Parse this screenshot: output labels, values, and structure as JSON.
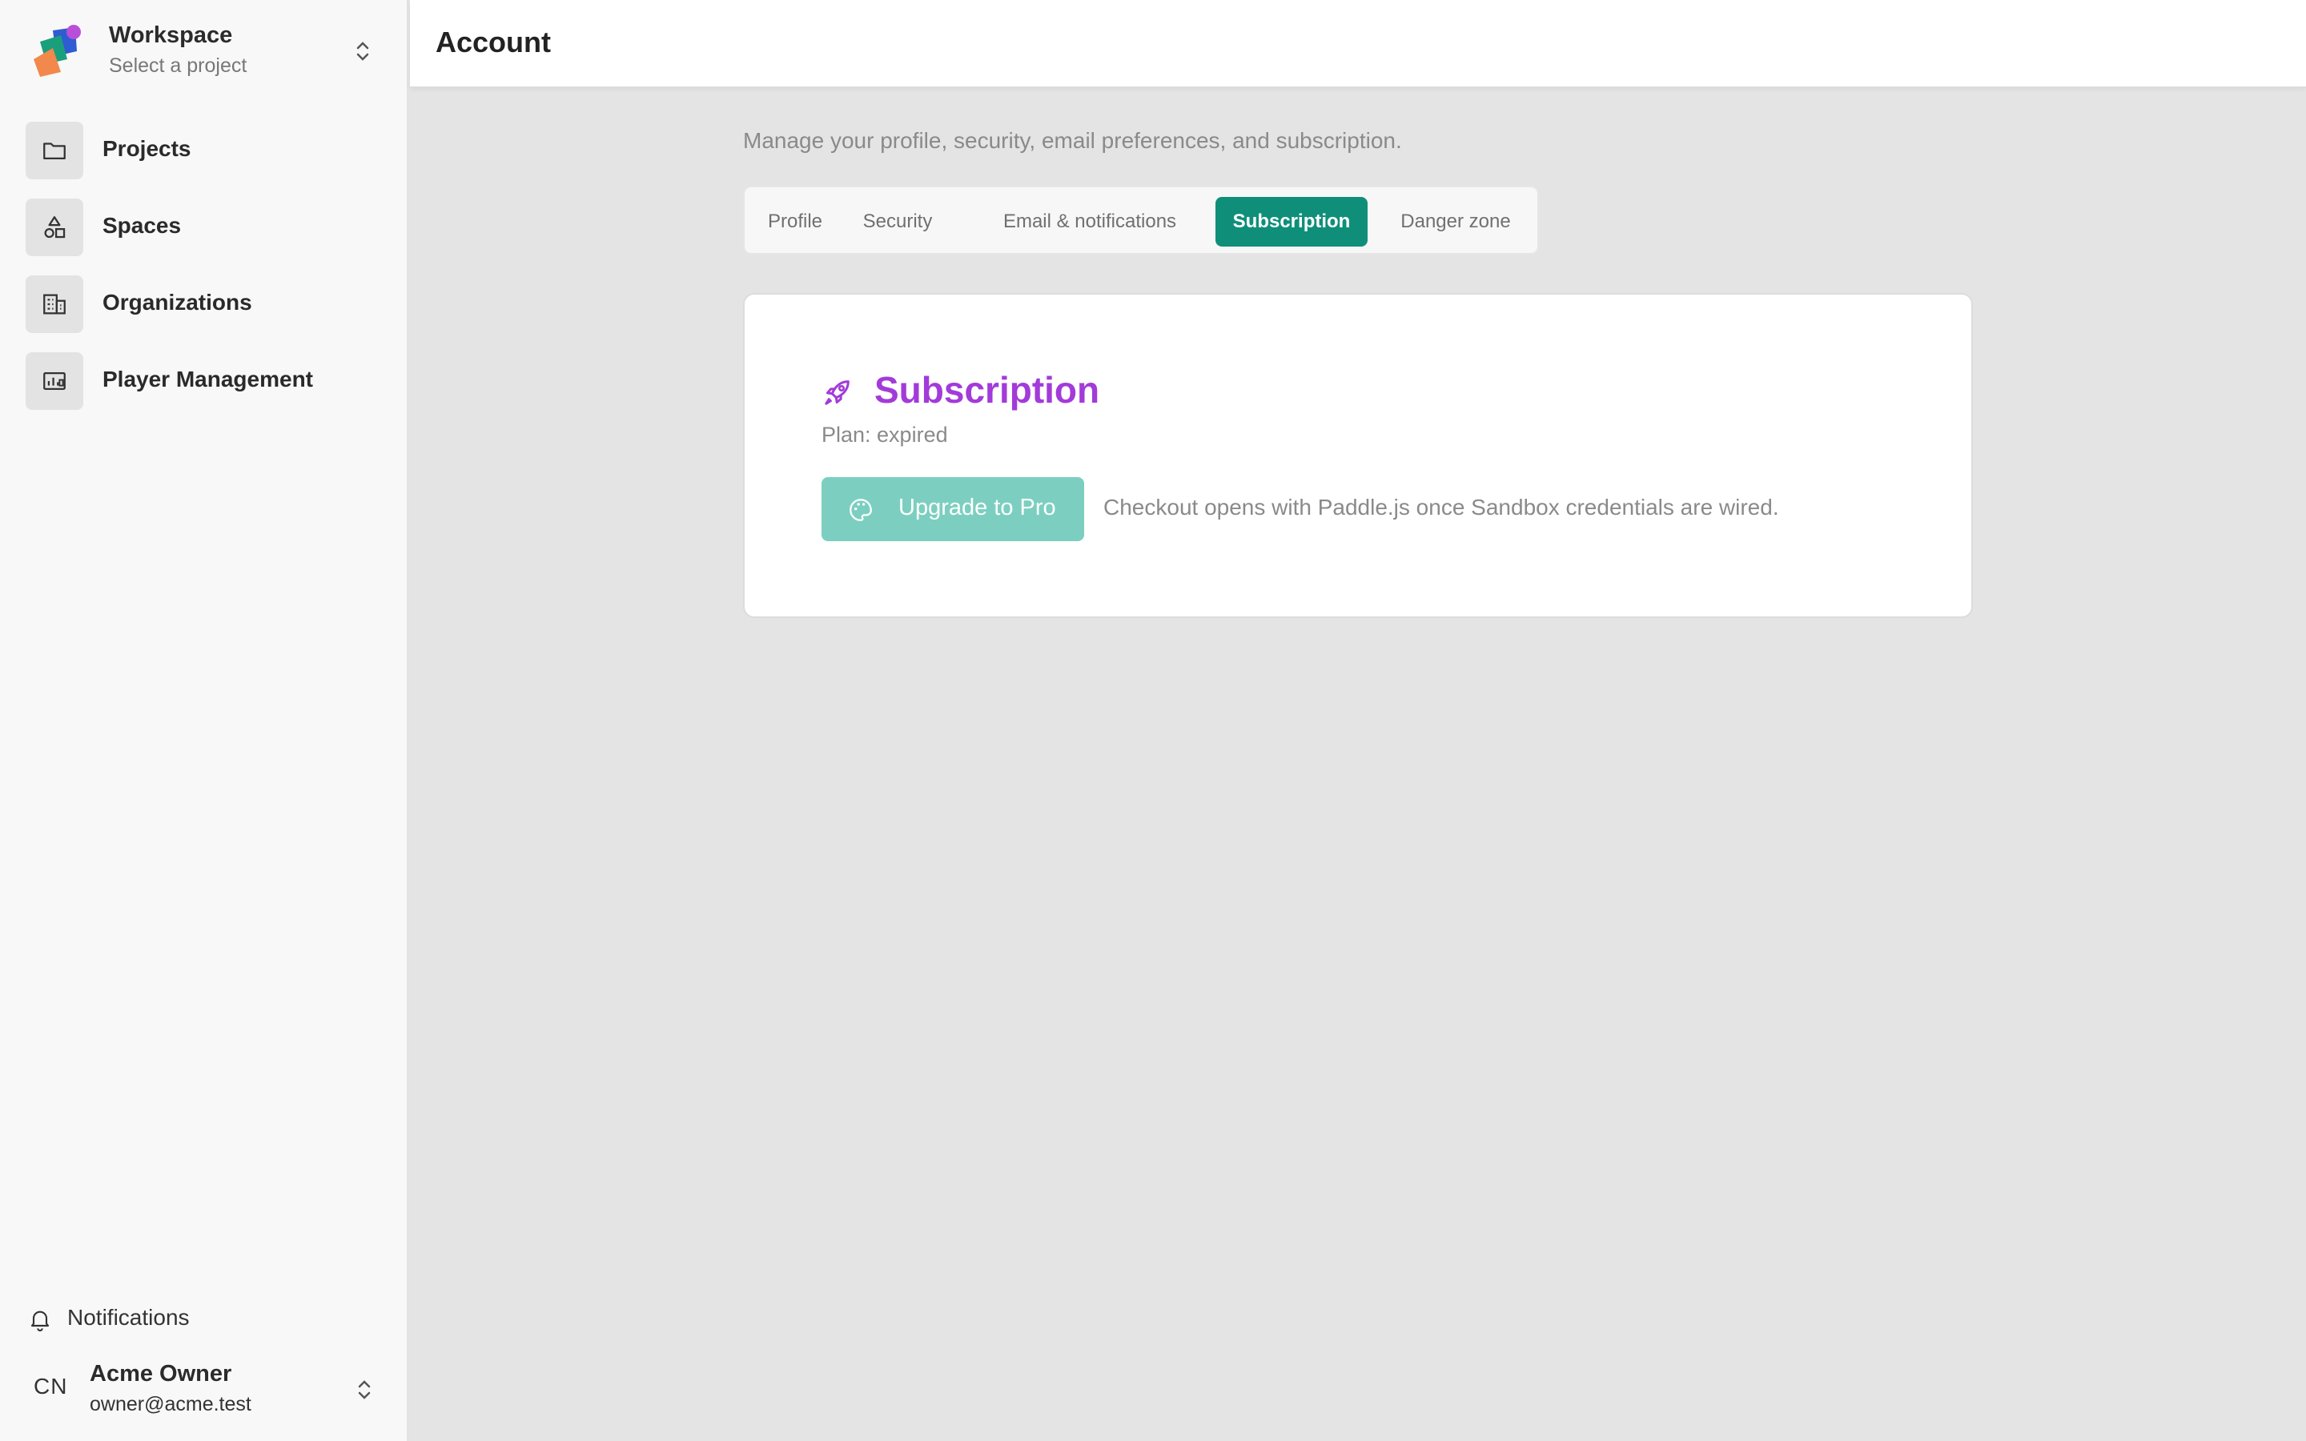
{
  "workspace": {
    "name": "Workspace",
    "subtitle": "Select a project"
  },
  "sidebar": {
    "items": [
      {
        "label": "Projects",
        "icon": "folder-icon"
      },
      {
        "label": "Spaces",
        "icon": "shapes-icon"
      },
      {
        "label": "Organizations",
        "icon": "building-icon"
      },
      {
        "label": "Player Management",
        "icon": "player-icon"
      }
    ],
    "notifications_label": "Notifications"
  },
  "user": {
    "initials": "CN",
    "name": "Acme Owner",
    "email": "owner@acme.test"
  },
  "header": {
    "title": "Account"
  },
  "main": {
    "description": "Manage your profile, security, email preferences, and subscription.",
    "tabs": [
      {
        "label": "Profile",
        "active": false
      },
      {
        "label": "Security",
        "active": false
      },
      {
        "label": "Email & notifications",
        "active": false
      },
      {
        "label": "Subscription",
        "active": true
      },
      {
        "label": "Danger zone",
        "active": false
      }
    ],
    "card": {
      "title": "Subscription",
      "plan": "Plan: expired",
      "upgrade_label": "Upgrade to Pro",
      "note": "Checkout opens with Paddle.js once Sandbox credentials are wired."
    }
  },
  "colors": {
    "accent": "#0f8f7a",
    "accent_disabled": "#7ccfc0",
    "title_purple": "#a23bd9",
    "background": "#e4e4e4",
    "sidebar_bg": "#f8f8f8"
  }
}
